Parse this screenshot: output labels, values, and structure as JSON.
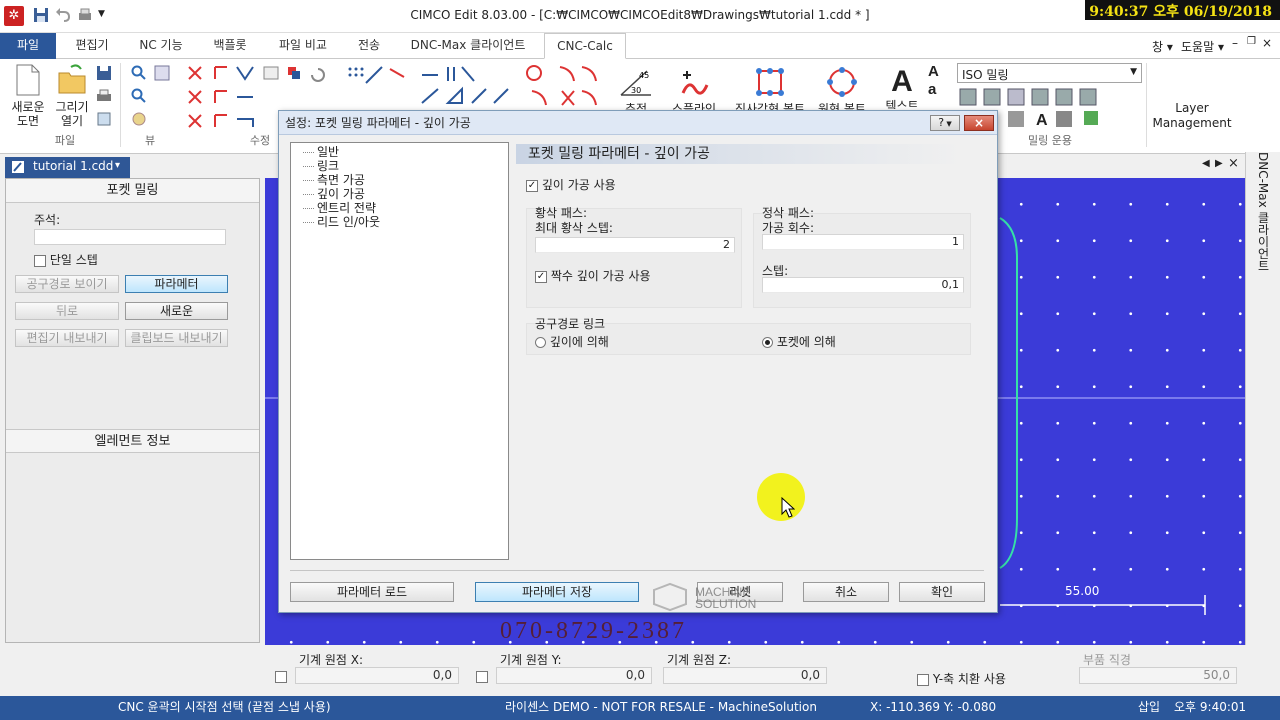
{
  "window": {
    "title": "CIMCO Edit 8.03.00 - [C:₩CIMCO₩CIMCOEdit8₩Drawings₩tutorial 1.cdd * ]",
    "clock": "9:40:37 오후 06/19/2018",
    "right_menu": {
      "window": "창",
      "help": "도움말"
    }
  },
  "menu_tabs": [
    "파일",
    "편집기",
    "NC 기능",
    "백플롯",
    "파일 비교",
    "전송",
    "DNC-Max 클라이언트",
    "CNC-Calc"
  ],
  "ribbon": {
    "new_drawing": "새로운\n도면",
    "open_drawing": "그리기\n열기",
    "groups": {
      "file": "파일",
      "view": "뷰",
      "edit": "수정",
      "milling_ops": "밀링 운용"
    },
    "big_buttons": {
      "chamfer": "추적",
      "spline": "스플라인",
      "rect_bolt": "직사각형 볼트",
      "circle_bolt": "원형 볼트",
      "text": "텍스트"
    },
    "chamfer_values": [
      "45",
      "30"
    ],
    "iso_select": "ISO 밀링",
    "layer_management": "Layer\nManagement"
  },
  "doc_tab": "tutorial 1.cdd",
  "left_panel": {
    "header": "포켓 밀링",
    "comment_label": "주석:",
    "comment_value": "",
    "single_step": "단일 스텝",
    "show_toolpath": "공구경로 보이기",
    "parameters": "파라메터",
    "back": "뒤로",
    "new": "새로운",
    "export_editor": "편집기 내보내기",
    "export_clipboard": "클립보드 내보내기",
    "element_info": "엘레먼트 정보"
  },
  "right_sidebar": "DNC-Max 클라이언트",
  "canvas": {
    "dimension": "55.00"
  },
  "coord_bar": {
    "mx_label": "기계 원점 X:",
    "mx_value": "0,0",
    "my_label": "기계 원점 Y:",
    "my_value": "0,0",
    "mz_label": "기계 원점 Z:",
    "mz_value": "0,0",
    "y_axis_swap": "Y-축 치환 사용",
    "part_dia_label": "부품 직경",
    "part_dia_value": "50,0"
  },
  "status_bar": {
    "hint": "CNC 윤곽의 시작점 선택 (끝점 스냅 사용)",
    "license": "라이센스 DEMO - NOT FOR RESALE - MachineSolution",
    "coords": "X: -110.369 Y: -0.080",
    "mode": "삽입",
    "time": "오후 9:40:01"
  },
  "dialog": {
    "title": "설정: 포켓 밀링 파라메터 - 깊이 가공",
    "tree": [
      "일반",
      "링크",
      "측면 가공",
      "깊이 가공",
      "엔트리 전략",
      "리드 인/아웃"
    ],
    "heading": "포켓 밀링 파라메터 - 깊이 가공",
    "use_depth": "깊이 가공 사용",
    "roughing_title": "황삭 패스:",
    "max_rough_step_label": "최대 황삭 스텝:",
    "max_rough_step_value": "2",
    "use_even_depth": "짝수 깊이 가공 사용",
    "finishing_title": "정삭 패스:",
    "finish_count_label": "가공 회수:",
    "finish_count_value": "1",
    "step_label": "스텝:",
    "step_value": "0,1",
    "toolpath_link": "공구경로 링크",
    "by_depth": "깊이에 의해",
    "by_pocket": "포켓에 의해",
    "buttons": {
      "load": "파라메터 로드",
      "save": "파라메터 저장",
      "reset": "리셋",
      "cancel": "취소",
      "ok": "확인"
    }
  },
  "watermark": {
    "phone": "070-8729-2387",
    "brand": "MACHINE SOLUTION"
  },
  "colors": {
    "accent": "#2b579a",
    "canvas": "#3b3bd8",
    "cursor_highlight": "#f2f207",
    "clock_text": "#f5e214"
  }
}
